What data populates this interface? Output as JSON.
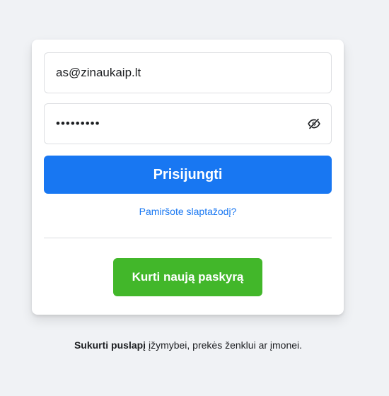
{
  "login_form": {
    "email_value": "as@zinaukaip.lt",
    "password_value": "•••••••••",
    "login_button_label": "Prisijungti",
    "forgot_password_link": "Pamiršote slaptažodį?",
    "create_account_button_label": "Kurti naują paskyrą"
  },
  "page_promo": {
    "create_page_link": "Sukurti puslapį",
    "rest_text": " įžymybei, prekės ženklui ar įmonei."
  },
  "colors": {
    "background": "#f0f2f5",
    "primary": "#1877f2",
    "success": "#42b72a",
    "text": "#1c1e21",
    "border": "#dddfe2"
  },
  "icons": {
    "password_toggle": "eye-off-icon"
  }
}
